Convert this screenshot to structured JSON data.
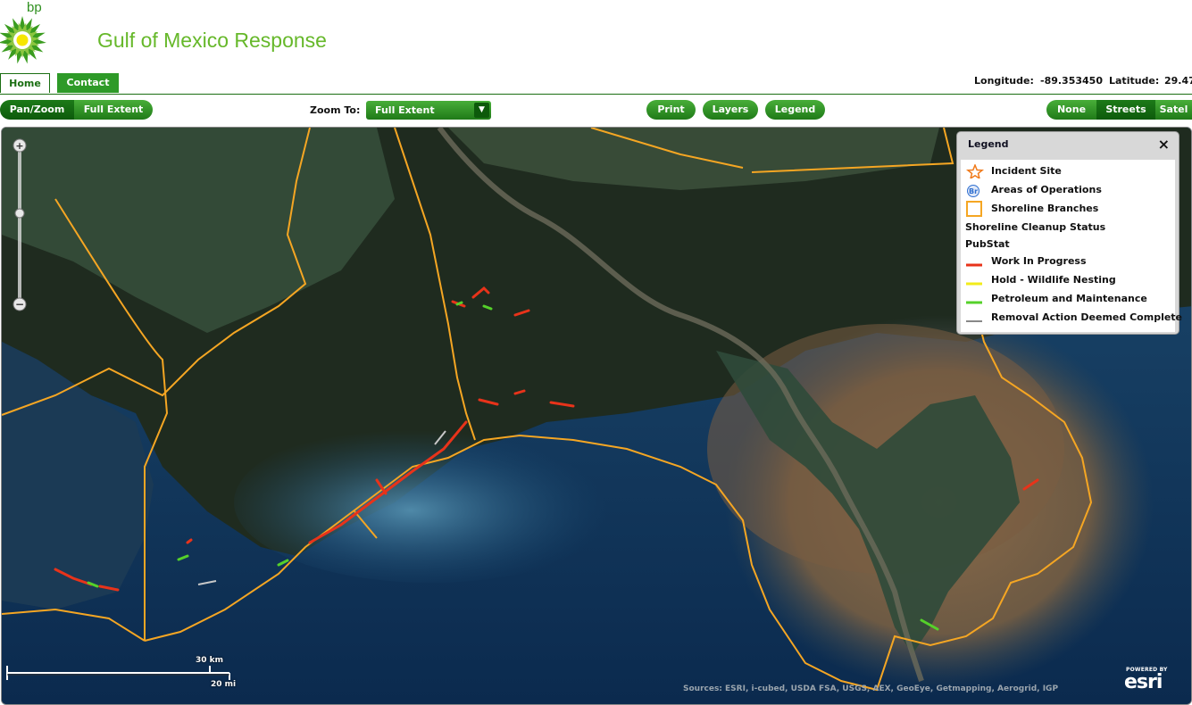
{
  "header": {
    "logo_text": "bp",
    "title": "Gulf of Mexico Response"
  },
  "nav": {
    "tabs": [
      {
        "label": "Home",
        "active": true
      },
      {
        "label": "Contact",
        "active": false
      }
    ]
  },
  "coords": {
    "longitude_label": "Longitude:",
    "longitude_value": "-89.353450",
    "latitude_label": "Latitude:",
    "latitude_value": "29.47"
  },
  "toolbar": {
    "pan_zoom": "Pan/Zoom",
    "full_extent": "Full Extent",
    "zoom_to_label": "Zoom To:",
    "zoom_to_value": "Full Extent",
    "print": "Print",
    "layers": "Layers",
    "legend": "Legend",
    "basemaps": [
      {
        "label": "None",
        "selected": false
      },
      {
        "label": "Streets",
        "selected": true
      },
      {
        "label": "Satel",
        "selected": false
      }
    ]
  },
  "legend": {
    "title": "Legend",
    "close": "×",
    "items": [
      {
        "label": "Incident Site",
        "symbol": "star-icon",
        "color": "#f07a1a"
      },
      {
        "label": "Areas of Operations",
        "symbol": "br-icon",
        "symbol_text": "Br",
        "color": "#2f6fd0"
      },
      {
        "label": "Shoreline Branches",
        "symbol": "square-outline-icon",
        "color": "#f5a623"
      },
      {
        "label": "Shoreline Cleanup Status",
        "symbol": "",
        "heading": true
      },
      {
        "label": "PubStat",
        "symbol": "",
        "heading": true
      },
      {
        "label": "Work In Progress",
        "symbol": "line-icon",
        "color": "#e8331a"
      },
      {
        "label": "Hold - Wildlife Nesting",
        "symbol": "line-icon",
        "color": "#f2ec1a"
      },
      {
        "label": "Petroleum and Maintenance",
        "symbol": "line-icon",
        "color": "#55d12a"
      },
      {
        "label": "Removal Action Deemed Complete",
        "symbol": "line-icon",
        "color": "#111111"
      }
    ]
  },
  "map": {
    "scale_km": "30 km",
    "scale_mi": "20 mi",
    "attribution": "Sources: ESRI, i-cubed, USDA FSA, USGS, AEX, GeoEye, Getmapping, Aerogrid, IGP",
    "esri_powered": "POWERED BY",
    "esri_mark": "esri",
    "colors": {
      "water": "#123a63",
      "land": "#1c2a1c",
      "sediment": "#7a5a3e",
      "boundary": "#f5a623",
      "work_in_progress": "#e8331a",
      "petroleum": "#55d12a"
    }
  }
}
